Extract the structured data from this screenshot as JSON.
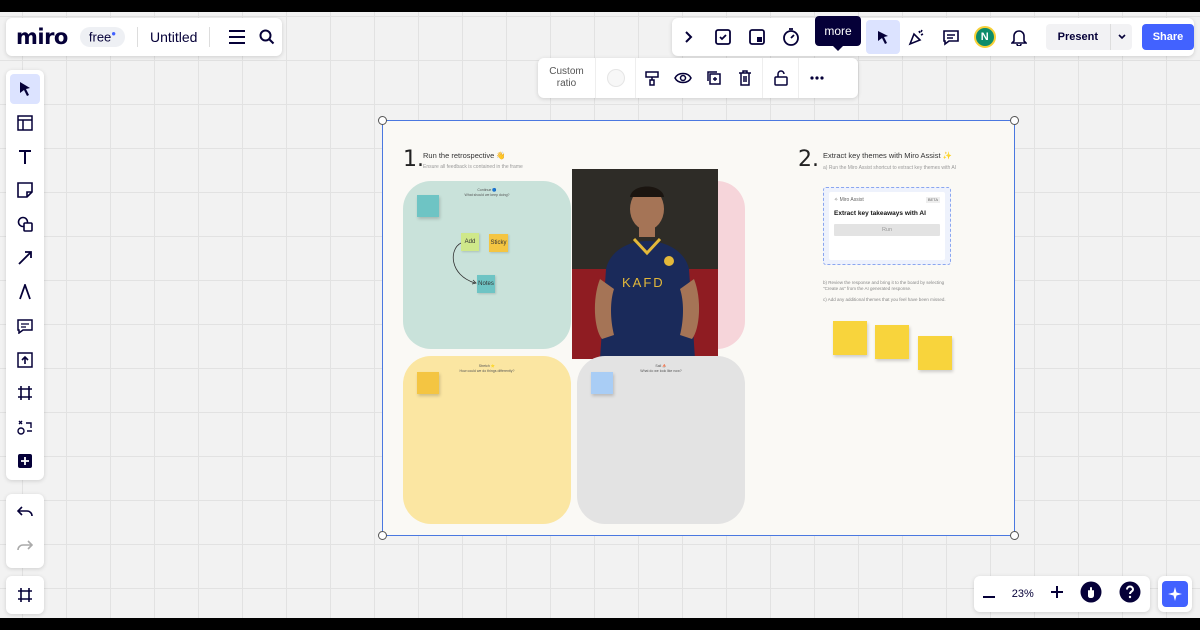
{
  "header": {
    "logo": "miro",
    "plan_badge": "free",
    "board_title": "Untitled"
  },
  "topbar": {
    "tooltip": "more",
    "avatar_initial": "N",
    "present_label": "Present",
    "share_label": "Share"
  },
  "context_toolbar": {
    "ratio_label_1": "Custom",
    "ratio_label_2": "ratio"
  },
  "zoom": {
    "value": "23%"
  },
  "board": {
    "step1": {
      "number": "1.",
      "title": "Run the retrospective 👋",
      "subtitle": "Ensure all feedback is contained in the frame"
    },
    "step2": {
      "number": "2.",
      "title": "Extract key themes with Miro Assist ✨",
      "subtitle": "a) Run the Miro Assist shortcut to extract key themes with AI",
      "note_b": "b) Review the response and bring it to the board by selecting \"Create as\" from the AI generated response.",
      "note_c": "c) Add any additional themes that you feel have been missed."
    },
    "assist": {
      "header": "Miro Assist",
      "badge": "BETA",
      "title": "Extract key takeaways with AI",
      "run_label": "Run"
    },
    "quad_top_left": {
      "label_1": "Continue 🔵",
      "label_2": "What should we keep doing?",
      "sticky_add": "Add",
      "sticky_sticky": "Sticky",
      "sticky_notes": "Notes"
    },
    "quad_bottom_left": {
      "label_1": "Stretch ⭐",
      "label_2": "How could we do things differently?"
    },
    "quad_bottom_right": {
      "label_1": "Sail ⛵",
      "label_2": "What do we look like now?"
    }
  },
  "colors": {
    "brand": "#4262ff",
    "quad_green": "#c9e2da",
    "quad_yellow": "#fbe6a2",
    "quad_grey": "#e3e3e3",
    "quad_pink": "#f6d5da",
    "sticky_yellow": "#f8d43c"
  }
}
